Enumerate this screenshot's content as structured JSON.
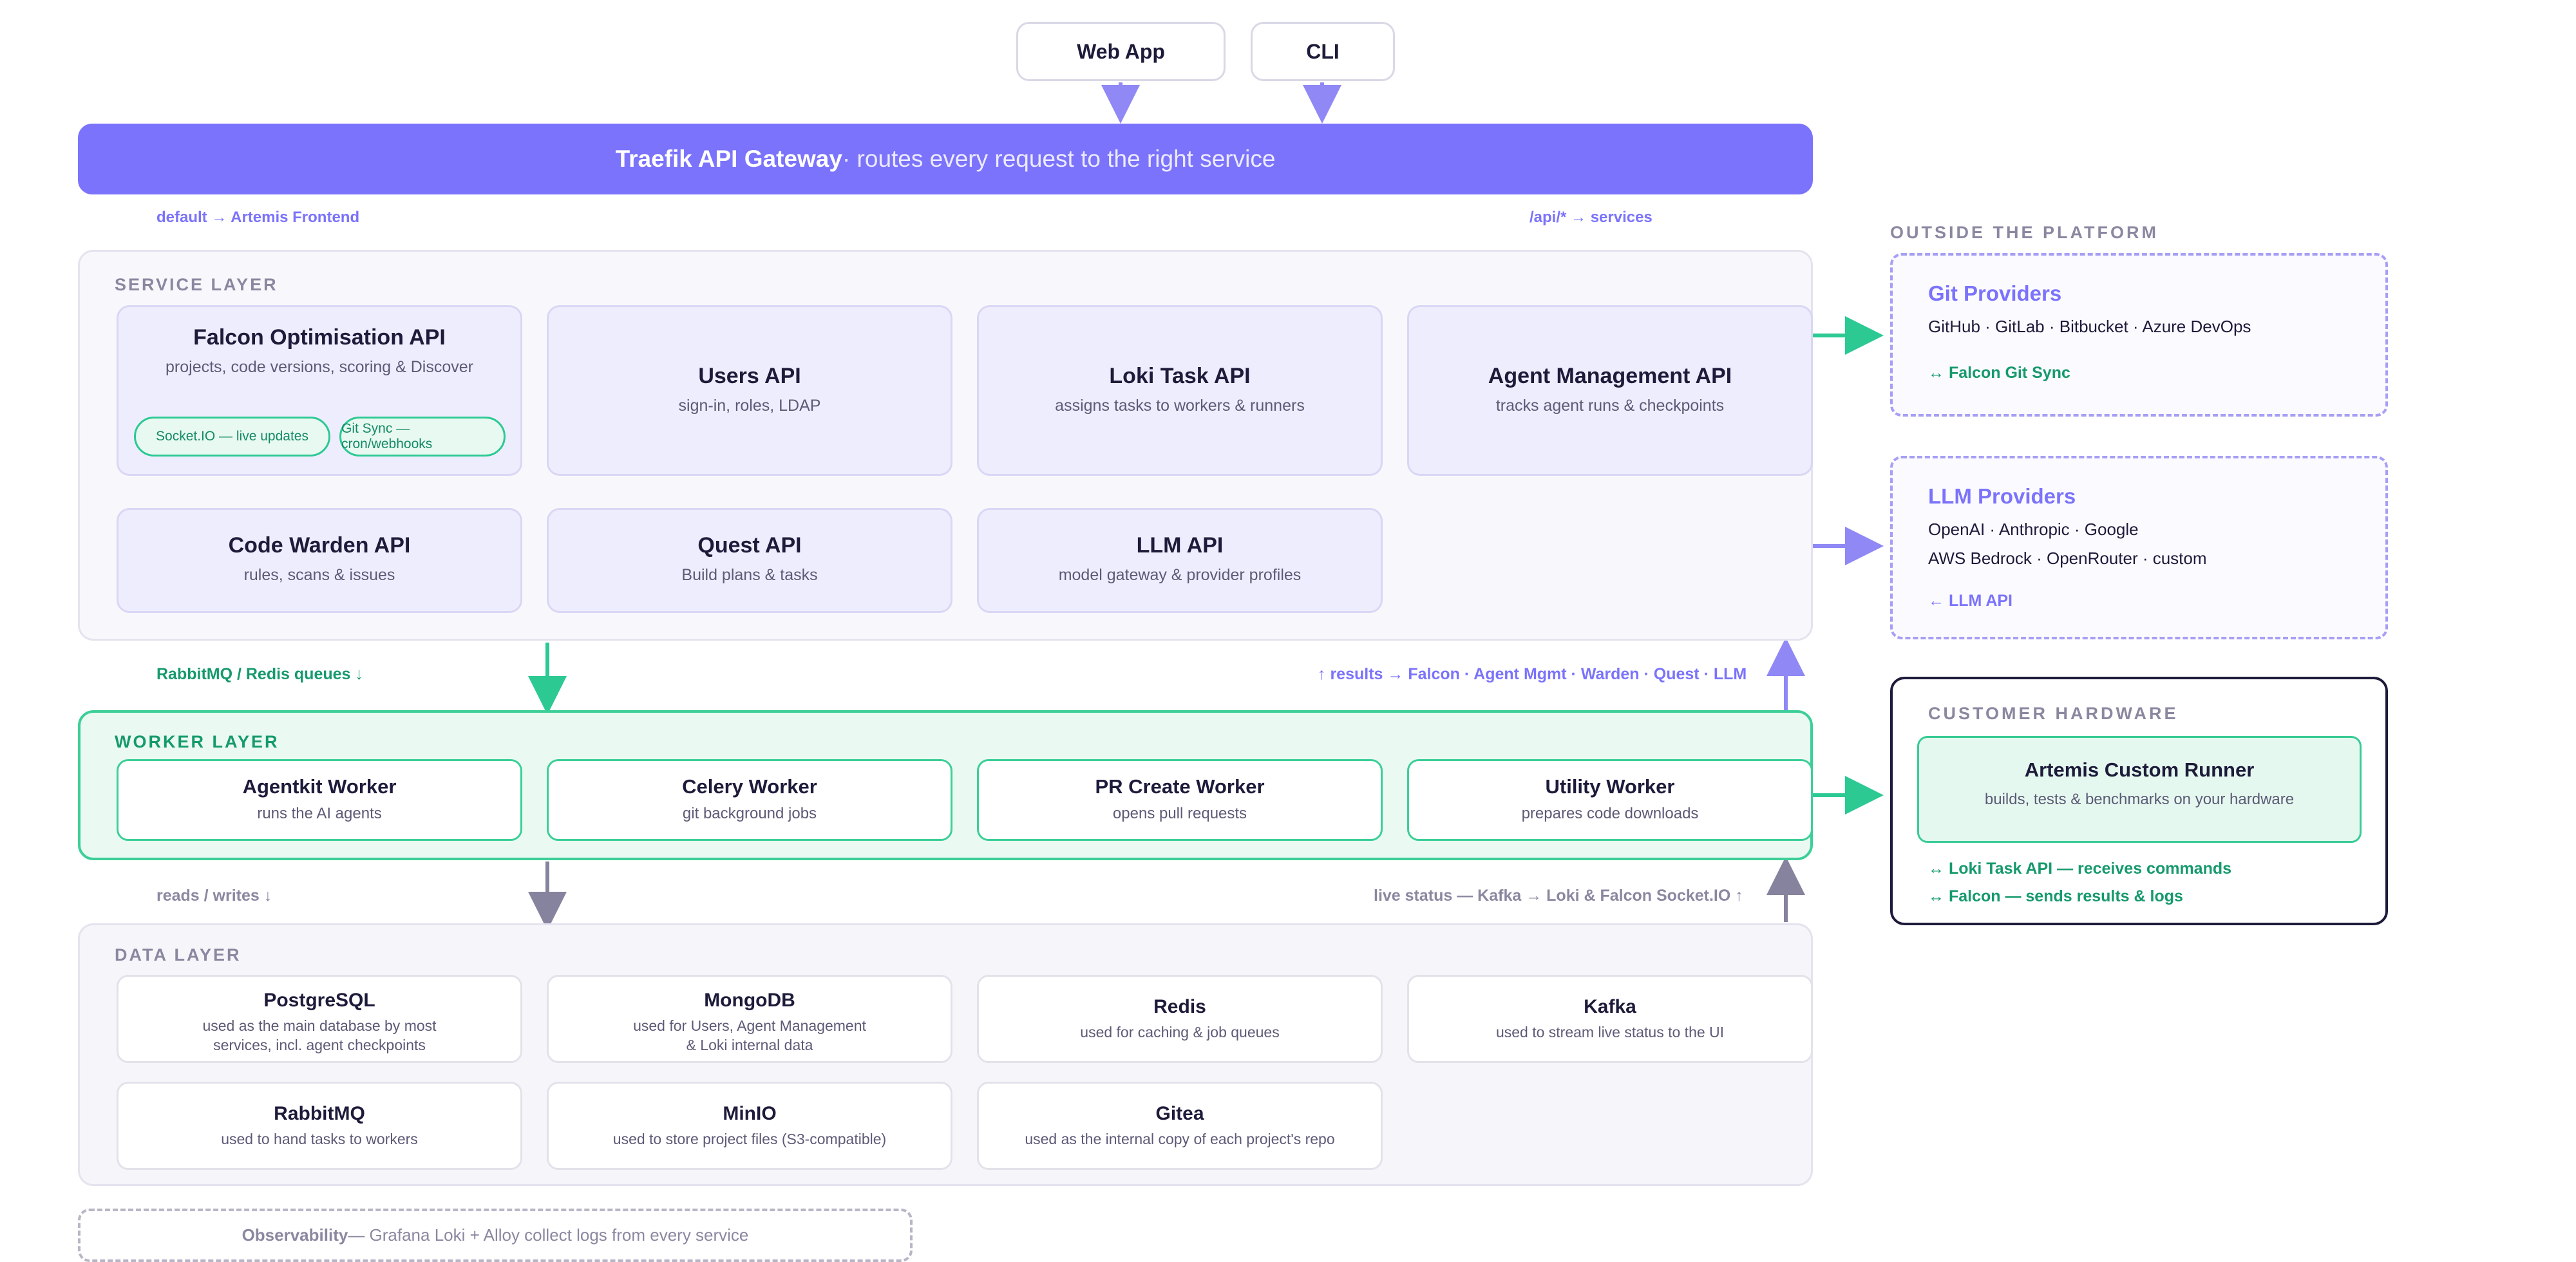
{
  "clients": {
    "web": "Web App",
    "cli": "CLI"
  },
  "gateway": {
    "title": "Traefik API Gateway",
    "subtitle": " · routes every request to the right service"
  },
  "routes": {
    "left": "default → Artemis Frontend",
    "right": "/api/* → services"
  },
  "service_layer": {
    "title": "SERVICE LAYER",
    "falcon": {
      "name": "Falcon Optimisation API",
      "desc": "projects, code versions, scoring & Discover",
      "pill1": "Socket.IO — live updates",
      "pill2": "Git Sync — cron/webhooks"
    },
    "services": [
      {
        "name": "Users API",
        "desc": "sign-in, roles, LDAP"
      },
      {
        "name": "Loki Task API",
        "desc": "assigns tasks to workers & runners"
      },
      {
        "name": "Agent Management API",
        "desc": "tracks agent runs & checkpoints"
      },
      {
        "name": "Code Warden API",
        "desc": "rules, scans & issues"
      },
      {
        "name": "Quest API",
        "desc": "Build plans & tasks"
      },
      {
        "name": "LLM API",
        "desc": "model gateway & provider profiles"
      }
    ]
  },
  "mid_labels": {
    "queues": "RabbitMQ / Redis queues ↓",
    "results": "↑ results → Falcon · Agent Mgmt · Warden · Quest · LLM",
    "reads": "reads / writes ↓",
    "live": "live status — Kafka → Loki & Falcon Socket.IO ↑"
  },
  "worker_layer": {
    "title": "WORKER LAYER",
    "workers": [
      {
        "name": "Agentkit Worker",
        "desc": "runs the AI agents"
      },
      {
        "name": "Celery Worker",
        "desc": "git background jobs"
      },
      {
        "name": "PR Create Worker",
        "desc": "opens pull requests"
      },
      {
        "name": "Utility Worker",
        "desc": "prepares code downloads"
      }
    ]
  },
  "data_layer": {
    "title": "DATA LAYER",
    "stores": [
      {
        "name": "PostgreSQL",
        "desc1": "used as the main database by most",
        "desc2": "services, incl. agent checkpoints"
      },
      {
        "name": "MongoDB",
        "desc1": "used for Users, Agent Management",
        "desc2": "& Loki internal data"
      },
      {
        "name": "Redis",
        "desc1": "used for caching & job queues",
        "desc2": ""
      },
      {
        "name": "Kafka",
        "desc1": "used to stream live status to the UI",
        "desc2": ""
      },
      {
        "name": "RabbitMQ",
        "desc1": "used to hand tasks to workers",
        "desc2": ""
      },
      {
        "name": "MinIO",
        "desc1": "used to store project files (S3-compatible)",
        "desc2": ""
      },
      {
        "name": "Gitea",
        "desc1": "used as the internal copy of each project's repo",
        "desc2": ""
      }
    ]
  },
  "observability": {
    "label": "Observability",
    "text": " — Grafana Loki + Alloy collect logs from every service"
  },
  "outside": {
    "heading": "OUTSIDE THE PLATFORM",
    "git": {
      "title": "Git Providers",
      "line1": "GitHub · GitLab · Bitbucket · Azure DevOps",
      "link": "↔ Falcon Git Sync"
    },
    "llm": {
      "title": "LLM Providers",
      "line1": "OpenAI · Anthropic · Google",
      "line2": "AWS Bedrock · OpenRouter · custom",
      "link": "← LLM API"
    }
  },
  "hardware": {
    "heading": "CUSTOMER HARDWARE",
    "runner": {
      "name": "Artemis Custom Runner",
      "desc": "builds, tests & benchmarks on your hardware"
    },
    "link1": "↔ Loki Task API — receives commands",
    "link2": "↔ Falcon — sends results & logs"
  },
  "colors": {
    "accent": "#7b73fb",
    "green": "#2cc993",
    "ink": "#1d1b3a",
    "gray": "#8a88a0"
  }
}
